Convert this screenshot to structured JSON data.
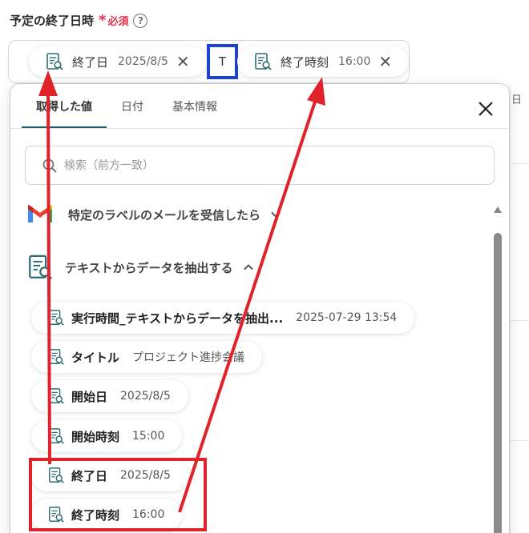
{
  "field": {
    "label": "予定の終了日時",
    "required_star": "*",
    "required_text": "必須",
    "help_glyph": "?"
  },
  "input_tokens": [
    {
      "label": "終了日",
      "value": "2025/8/5"
    },
    {
      "separator": "T"
    },
    {
      "label": "終了時刻",
      "value": "16:00"
    }
  ],
  "right_hint": "日",
  "panel": {
    "tabs": [
      {
        "label": "取得した値",
        "active": true
      },
      {
        "label": "日付",
        "active": false
      },
      {
        "label": "基本情報",
        "active": false
      }
    ],
    "search_placeholder": "検索（前方一致）",
    "groups": [
      {
        "title": "特定のラベルのメールを受信したら",
        "icon": "gmail-icon",
        "expanded": false
      },
      {
        "title": "テキストからデータを抽出する",
        "icon": "document-search-icon",
        "expanded": true
      }
    ],
    "items": [
      {
        "label": "実行時間_テキストからデータを抽出...",
        "value": "2025-07-29 13:54"
      },
      {
        "label": "タイトル",
        "value": "プロジェクト進捗会議"
      },
      {
        "label": "開始日",
        "value": "2025/8/5"
      },
      {
        "label": "開始時刻",
        "value": "15:00"
      },
      {
        "label": "終了日",
        "value": "2025/8/5"
      },
      {
        "label": "終了時刻",
        "value": "16:00"
      }
    ]
  },
  "colors": {
    "accent_tab": "#1c5c66",
    "required": "#e0334f",
    "annotation_red": "#e0232a",
    "annotation_blue": "#1b44d6",
    "doc_icon": "#2f6e76"
  },
  "icons": {
    "close": "close-icon",
    "search": "search-icon",
    "chevron_down": "chevron-down-icon",
    "chevron_up": "chevron-up-icon",
    "token_remove": "x-icon"
  }
}
